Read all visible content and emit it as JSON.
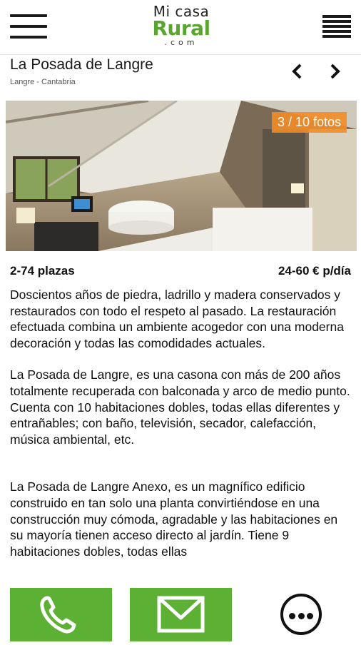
{
  "header": {
    "menu_icon": "hamburger-menu-icon",
    "logo": {
      "line1": "Mi casa",
      "line2": "Rural",
      "line3": ".com"
    },
    "list_icon": "list-view-icon"
  },
  "property": {
    "name": "La Posada de Langre",
    "location": "Langre - Cantabria",
    "prev_icon": "chevron-left-icon",
    "next_icon": "chevron-right-icon"
  },
  "gallery": {
    "counter": "3 / 10 fotos"
  },
  "info": {
    "capacity": "2-74 plazas",
    "price": "24-60 € p/día"
  },
  "description": {
    "p1": "Doscientos años de piedra, ladrillo y madera conservados y restaurados con todo el respeto al pasado. La restauración efectuada combina un ambiente acogedor con una moderna decoración y todas las comodidades actuales.",
    "p2": "La Posada de Langre, es una casona con más de 200 años totalmente recuperada con balconada y arco de medio punto. Cuenta con 10 habitaciones dobles, todas ellas diferentes y entrañables; con baño, televisión, secador, calefacción, música ambiental, etc.",
    "p3": "La Posada de Langre Anexo, es un magnífico edificio construido en tan solo una planta convirtiéndose en una construcción muy cómoda, agradable y las habitaciones en su mayoría tienen acceso directo al jardín. Tiene 9 habitaciones dobles, todas ellas"
  },
  "actions": {
    "call_icon": "phone-icon",
    "mail_icon": "envelope-icon",
    "more_icon": "more-options-icon",
    "button_color": "#5cb033"
  }
}
